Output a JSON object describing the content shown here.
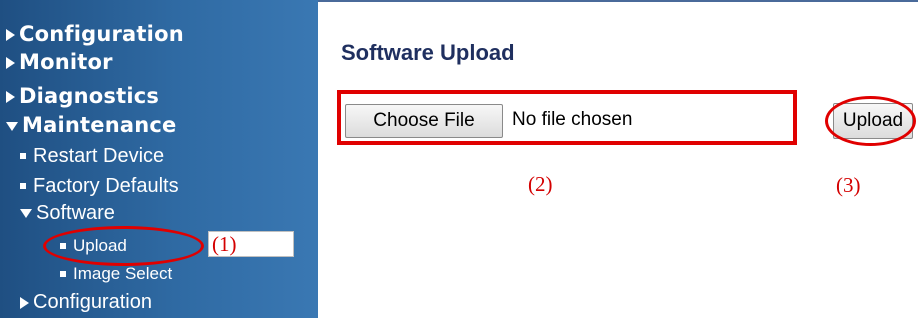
{
  "sidebar": {
    "items": [
      {
        "label": "Configuration",
        "icon": "triangle-right-icon"
      },
      {
        "label": "Monitor",
        "icon": "triangle-right-icon"
      },
      {
        "label": "Diagnostics",
        "icon": "triangle-right-icon"
      },
      {
        "label": "Maintenance",
        "icon": "triangle-down-icon"
      }
    ],
    "maintenance_children": [
      {
        "label": "Restart Device"
      },
      {
        "label": "Factory Defaults"
      },
      {
        "label": "Software"
      },
      {
        "label": "Configuration"
      }
    ],
    "software_children": [
      {
        "label": "Upload"
      },
      {
        "label": "Image Select"
      }
    ]
  },
  "annotations": {
    "label_1": "(1)",
    "label_2": "(2)",
    "label_3": "(3)",
    "highlight_color": "#e00000"
  },
  "main": {
    "title": "Software Upload",
    "choose_file_label": "Choose File",
    "file_status": "No file chosen",
    "upload_label": "Upload"
  },
  "colors": {
    "sidebar_bg": "#2f6aa3",
    "title_color": "#1f2f5f",
    "annotation_red": "#d40000"
  }
}
